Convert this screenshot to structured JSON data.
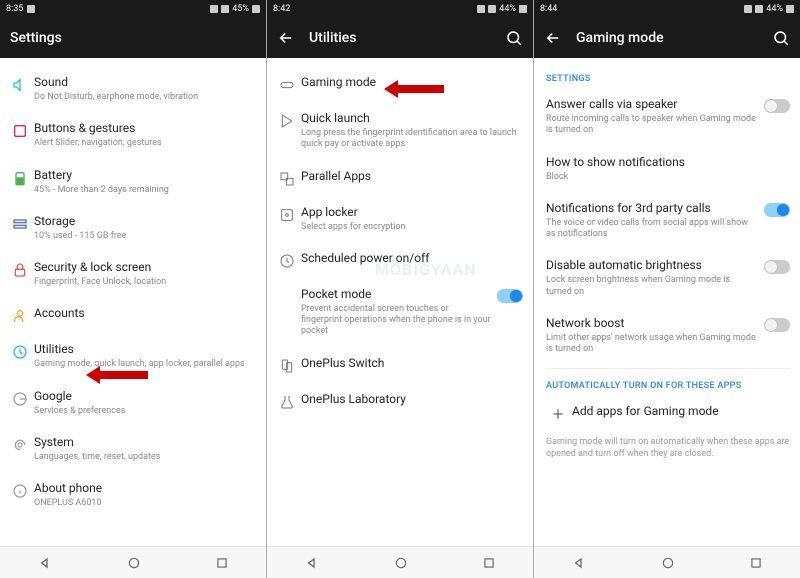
{
  "panel1": {
    "statusbar": {
      "time": "8:35",
      "battery": "45%"
    },
    "appbar": {
      "title": "Settings"
    },
    "items": [
      {
        "label": "Sound",
        "sub": "Do Not Disturb, earphone mode, vibration",
        "icon": "sound"
      },
      {
        "label": "Buttons & gestures",
        "sub": "Alert Slider, navigation, gestures",
        "icon": "buttons"
      },
      {
        "label": "Battery",
        "sub": "45% - More than 2 days remaining",
        "icon": "battery"
      },
      {
        "label": "Storage",
        "sub": "10% used - 115 GB free",
        "icon": "storage"
      },
      {
        "label": "Security & lock screen",
        "sub": "Fingerprint, Face Unlock, location",
        "icon": "security"
      },
      {
        "label": "Accounts",
        "sub": "",
        "icon": "accounts"
      },
      {
        "label": "Utilities",
        "sub": "Gaming mode, quick launch, app locker, parallel apps",
        "icon": "utilities"
      },
      {
        "label": "Google",
        "sub": "Services & preferences",
        "icon": "google"
      },
      {
        "label": "System",
        "sub": "Languages, time, reset, updates",
        "icon": "system"
      },
      {
        "label": "About phone",
        "sub": "ONEPLUS A6010",
        "icon": "about"
      }
    ]
  },
  "panel2": {
    "statusbar": {
      "time": "8:42",
      "battery": "44%"
    },
    "appbar": {
      "title": "Utilities"
    },
    "items": [
      {
        "label": "Gaming mode",
        "sub": "",
        "icon": "gaming"
      },
      {
        "label": "Quick launch",
        "sub": "Long press the fingerprint identification area to launch quick pay or activate apps",
        "icon": "quick"
      },
      {
        "label": "Parallel Apps",
        "sub": "",
        "icon": "parallel"
      },
      {
        "label": "App locker",
        "sub": "Select apps for encryption",
        "icon": "locker"
      },
      {
        "label": "Scheduled power on/off",
        "sub": "",
        "icon": "schedule"
      },
      {
        "label": "Pocket mode",
        "sub": "Prevent accidental screen touches or fingerprint operations when the phone is in your pocket",
        "icon": "pocket",
        "toggle": true,
        "on": true
      },
      {
        "label": "OnePlus Switch",
        "sub": "",
        "icon": "switch"
      },
      {
        "label": "OnePlus Laboratory",
        "sub": "",
        "icon": "lab"
      }
    ]
  },
  "panel3": {
    "statusbar": {
      "time": "8:44",
      "battery": "44%"
    },
    "appbar": {
      "title": "Gaming mode"
    },
    "section1": "SETTINGS",
    "items": [
      {
        "label": "Answer calls via speaker",
        "sub": "Route incoming calls to speaker when Gaming mode is turned on",
        "toggle": true,
        "on": false
      },
      {
        "label": "How to show notifications",
        "sub": "Block"
      },
      {
        "label": "Notifications for 3rd party calls",
        "sub": "The voice or video calls from social apps will show as notifications",
        "toggle": true,
        "on": true
      },
      {
        "label": "Disable automatic brightness",
        "sub": "Lock screen brightness when Gaming mode is turned on",
        "toggle": true,
        "on": false
      },
      {
        "label": "Network boost",
        "sub": "Limit other apps' network usage when Gaming mode is turned on",
        "toggle": true,
        "on": false
      }
    ],
    "section2": "AUTOMATICALLY TURN ON FOR THESE APPS",
    "add": "Add apps for Gaming mode",
    "footnote": "Gaming mode will turn on automatically when these apps are opened and turn off when they are closed."
  },
  "watermark": "MOBIGYAAN"
}
